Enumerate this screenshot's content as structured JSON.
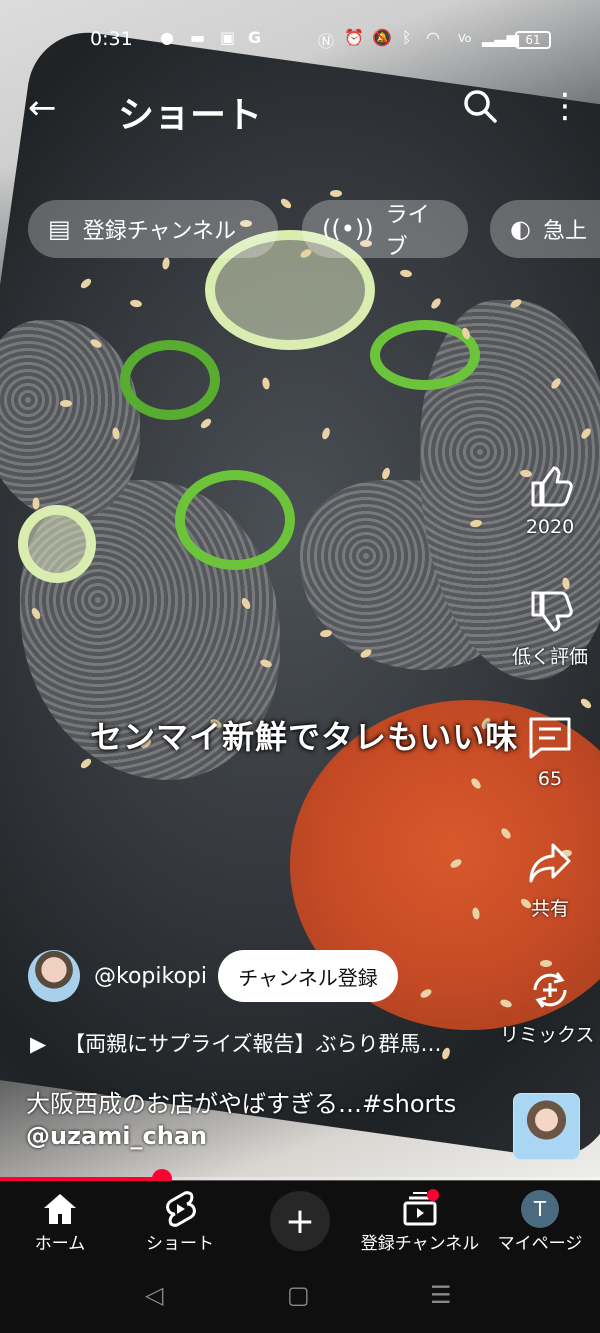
{
  "status_bar": {
    "time": "0:31",
    "battery": "61"
  },
  "header": {
    "title": "ショート"
  },
  "chips": [
    {
      "label": "登録チャンネル",
      "icon": "subscriptions-icon"
    },
    {
      "label": "ライブ",
      "icon": "live-icon"
    },
    {
      "label": "急上",
      "icon": "trending-icon"
    }
  ],
  "video": {
    "overlay_text": "センマイ新鮮でタレもいい味",
    "progress_fraction": 0.27
  },
  "actions": {
    "like_count": "2020",
    "dislike_label": "低く評価",
    "comment_count": "65",
    "share_label": "共有",
    "remix_label": "リミックス"
  },
  "channel": {
    "handle": "@kopikopi",
    "subscribe_label": "チャンネル登録"
  },
  "related": {
    "title": "【両親にサプライズ報告】ぶらり群馬…"
  },
  "caption": {
    "line1": "大阪西成のお店がやばすぎる…#shorts",
    "line2": "@uzami_chan"
  },
  "nav": {
    "home": "ホーム",
    "shorts": "ショート",
    "subscriptions": "登録チャンネル",
    "mypage": "マイページ",
    "avatar_letter": "T"
  },
  "colors": {
    "accent": "#ff0033",
    "nav_bg": "#0f0f0f"
  }
}
